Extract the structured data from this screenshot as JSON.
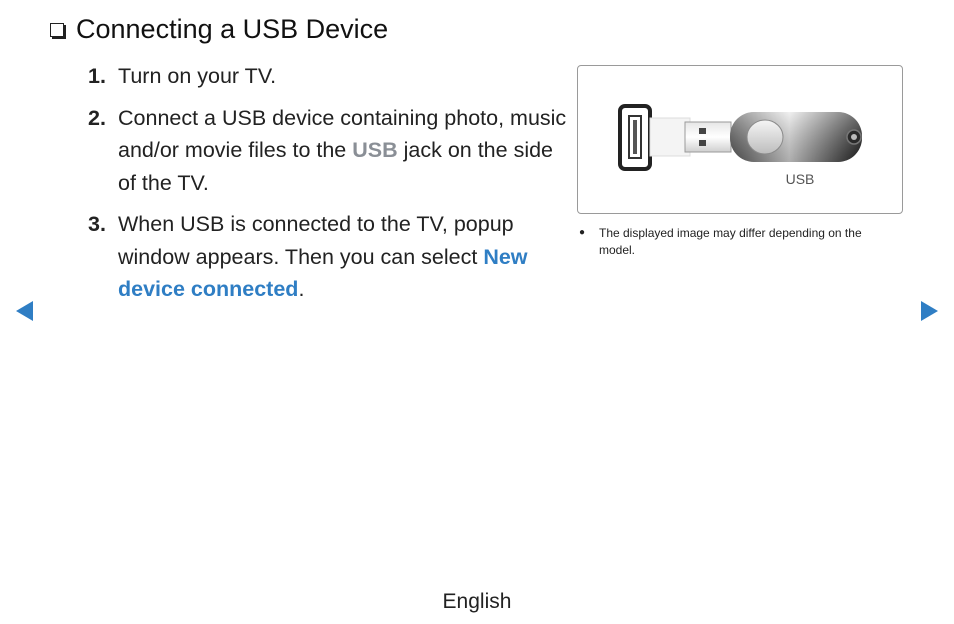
{
  "heading": {
    "title": "Connecting a USB Device"
  },
  "steps": [
    {
      "num": "1.",
      "text": "Turn on your TV."
    },
    {
      "num": "2.",
      "pre": "Connect a USB device containing photo, music and/or movie files to the ",
      "highlight": "USB",
      "post": " jack on the side of the TV."
    },
    {
      "num": "3.",
      "pre": "When USB is connected to the TV, popup window appears. Then you can select ",
      "highlight": "New device connected",
      "post": "."
    }
  ],
  "figure": {
    "label": "USB"
  },
  "note": {
    "text": "The displayed image may differ depending on the model."
  },
  "footer": {
    "language": "English"
  },
  "colors": {
    "accent": "#2f7ec4",
    "usb_highlight": "#8a8f96"
  },
  "icons": {
    "heading": "checkbox-icon",
    "prev": "left-arrow-icon",
    "next": "right-arrow-icon",
    "bullet": "bullet-icon"
  }
}
